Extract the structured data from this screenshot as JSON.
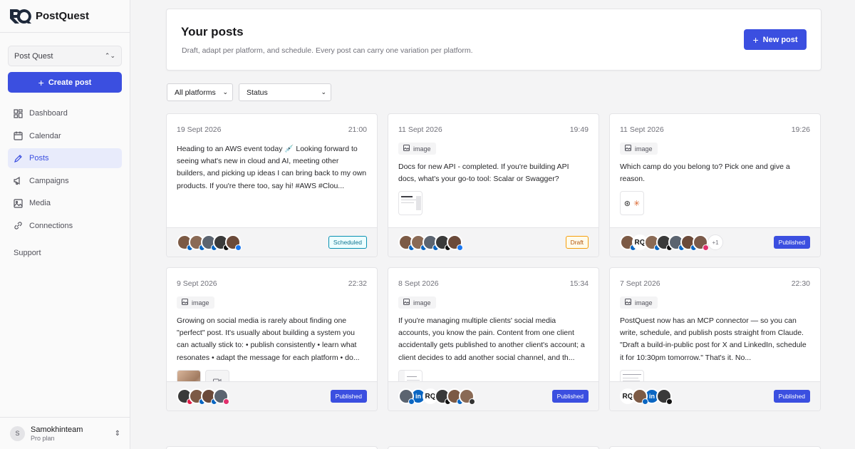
{
  "app": {
    "name": "PostQuest",
    "logo_text": "RQ"
  },
  "sidebar": {
    "workspace": "Post Quest",
    "create_label": "Create post",
    "items": [
      {
        "label": "Dashboard",
        "icon": "grid-icon"
      },
      {
        "label": "Calendar",
        "icon": "calendar-icon"
      },
      {
        "label": "Posts",
        "icon": "pen-icon",
        "active": true
      },
      {
        "label": "Campaigns",
        "icon": "megaphone-icon"
      },
      {
        "label": "Media",
        "icon": "image-icon"
      },
      {
        "label": "Connections",
        "icon": "link-icon"
      }
    ],
    "support": "Support",
    "user": {
      "initial": "S",
      "name": "Samokhinteam",
      "plan": "Pro plan"
    }
  },
  "header": {
    "title": "Your posts",
    "subtitle": "Draft, adapt per platform, and schedule. Every post can carry one variation per platform.",
    "new_post": "New post"
  },
  "filters": {
    "platforms": "All platforms",
    "status": "Status"
  },
  "posts": [
    {
      "date": "19 Sept 2026",
      "time": "21:00",
      "tag": "",
      "text": "Heading to an AWS event today 💉 Looking forward to seeing what's new in cloud and AI, meeting other builders, and picking up ideas I can bring back to my own products. If you're there too, say hi! #AWS #Clou...",
      "status": "Scheduled"
    },
    {
      "date": "11 Sept 2026",
      "time": "19:49",
      "tag": "image",
      "text": "Docs for new API - completed. If you're building API docs, what's your go-to tool: Scalar or Swagger?",
      "status": "Draft"
    },
    {
      "date": "11 Sept 2026",
      "time": "19:26",
      "tag": "image",
      "text": "Which camp do you belong to? Pick one and give a reason.",
      "status": "Published",
      "more": "+1"
    },
    {
      "date": "9 Sept 2026",
      "time": "22:32",
      "tag": "image",
      "text": "Growing on social media is rarely about finding one \"perfect\" post. It's usually about building a system you can actually stick to: • publish consistently • learn what resonates • adapt the message for each platform • do...",
      "status": "Published"
    },
    {
      "date": "8 Sept 2026",
      "time": "15:34",
      "tag": "image",
      "text": "If you're managing multiple clients' social media accounts, you know the pain. Content from one client accidentally gets published to another client's account; a client decides to add another social channel, and th...",
      "status": "Published"
    },
    {
      "date": "7 Sept 2026",
      "time": "22:30",
      "tag": "image",
      "text": "PostQuest now has an MCP connector — so you can write, schedule, and publish posts straight from Claude. \"Draft a build-in-public post for X and LinkedIn, schedule it for 10:30pm tomorrow.\" That's it. No...",
      "status": "Published"
    }
  ],
  "colors": {
    "accent": "#3b4fe0",
    "facebook": "#1877f2",
    "linkedin": "#0a66c2",
    "instagram": "#e1306c",
    "x": "#111111"
  }
}
